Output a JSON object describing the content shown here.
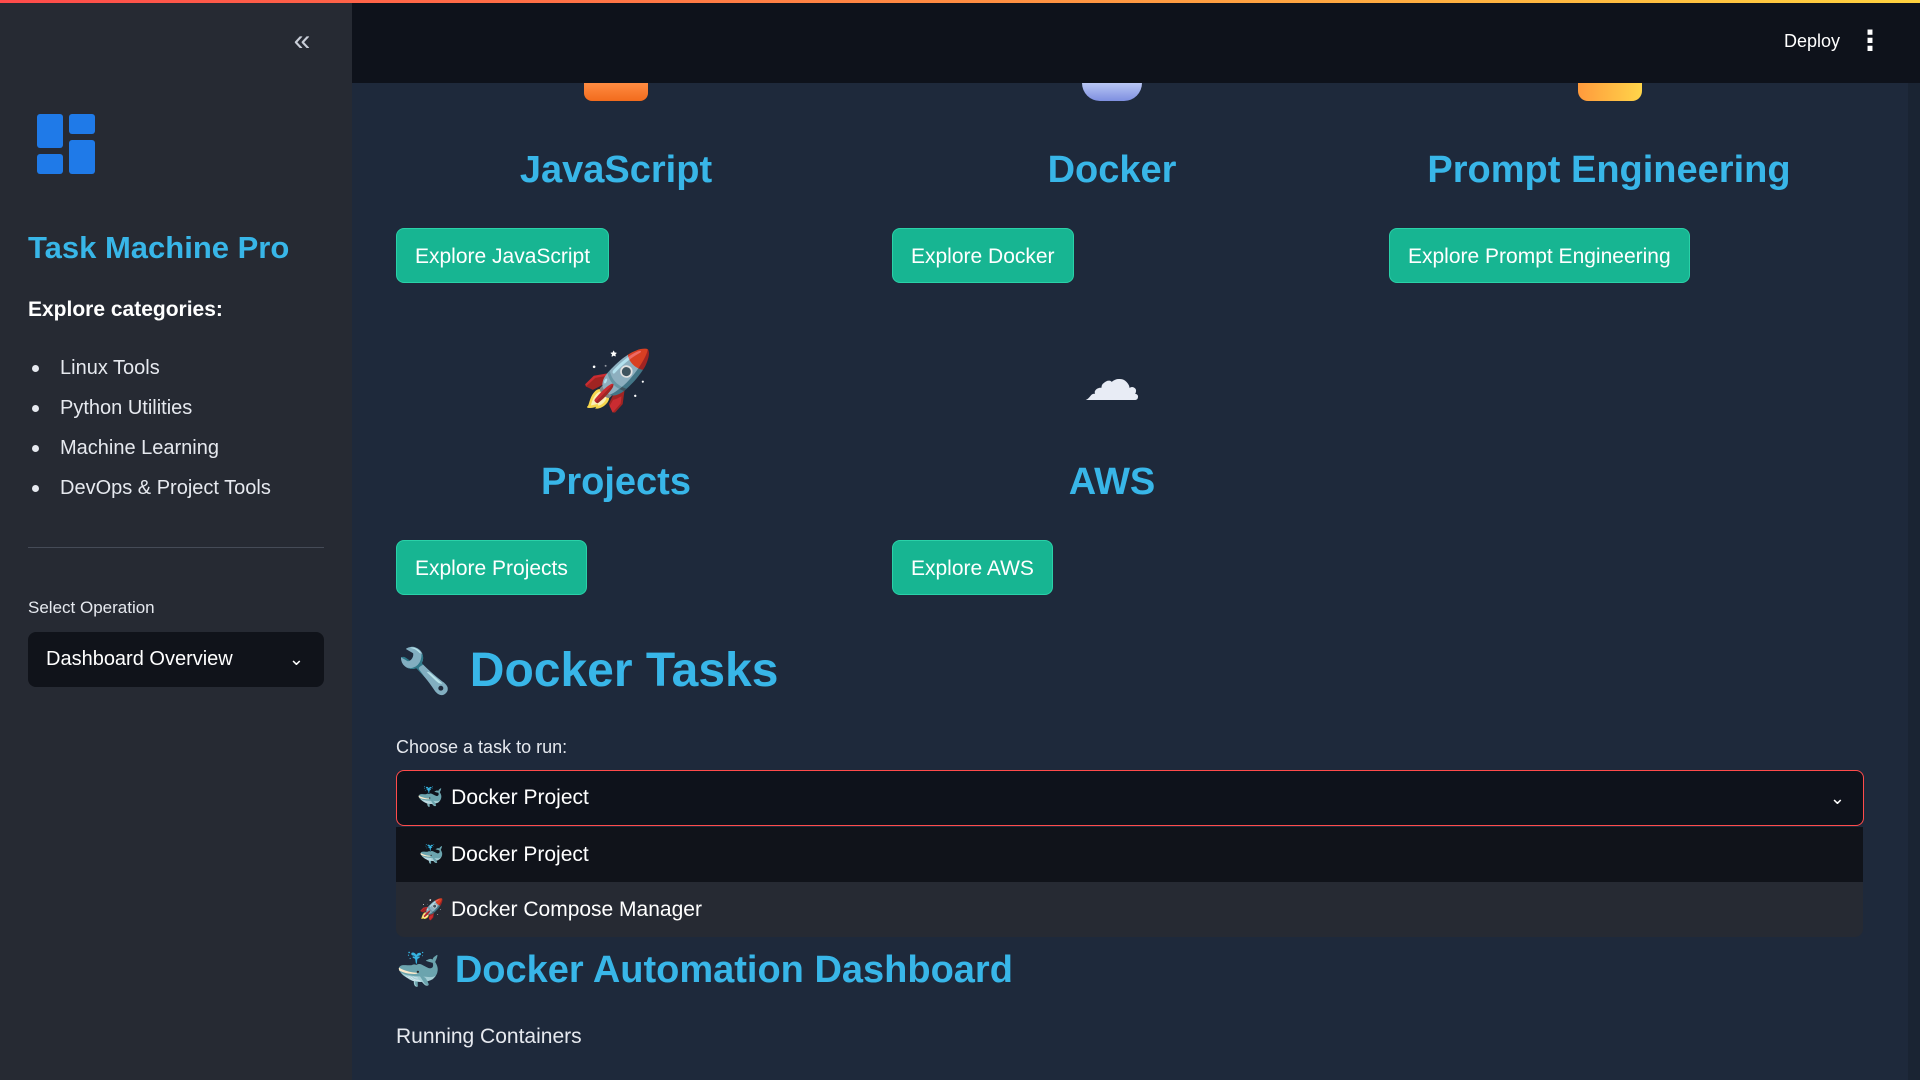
{
  "sidebar": {
    "collapse_label": "«",
    "logo_icon": "dashboard-grid-icon",
    "title": "Task Machine Pro",
    "subtitle": "Explore categories:",
    "categories": [
      "Linux Tools",
      "Python Utilities",
      "Machine Learning",
      "DevOps & Project Tools"
    ],
    "select_label": "Select Operation",
    "select_value": "Dashboard Overview"
  },
  "header": {
    "deploy": "Deploy",
    "menu": "⋮"
  },
  "cards": [
    {
      "title": "JavaScript",
      "button": "Explore JavaScript",
      "icon": "orange-tile-icon"
    },
    {
      "title": "Docker",
      "button": "Explore Docker",
      "icon": "whale-icon"
    },
    {
      "title": "Prompt Engineering",
      "button": "Explore Prompt Engineering",
      "icon": "sparkle-icon"
    },
    {
      "title": "Projects",
      "button": "Explore Projects",
      "icon": "rocket-icon",
      "glyph": "🚀"
    },
    {
      "title": "AWS",
      "button": "Explore AWS",
      "icon": "cloud-icon",
      "glyph": "☁"
    }
  ],
  "section": {
    "icon": "wrench-icon",
    "glyph": "🔧",
    "title": "Docker Tasks",
    "choose_label": "Choose a task to run:",
    "selected": "Docker Project",
    "selected_glyph": "🐳",
    "options": [
      {
        "glyph": "🐳",
        "label": "Docker Project"
      },
      {
        "glyph": "🚀",
        "label": "Docker Compose Manager"
      }
    ]
  },
  "dashboard": {
    "glyph": "🐳",
    "title": "Docker Automation Dashboard",
    "running": "Running Containers"
  },
  "colors": {
    "accent": "#38b6e8",
    "button": "#17b592",
    "sidebar_bg": "#262a33",
    "main_bg": "#1e293b",
    "error_border": "#ff4b4b"
  }
}
